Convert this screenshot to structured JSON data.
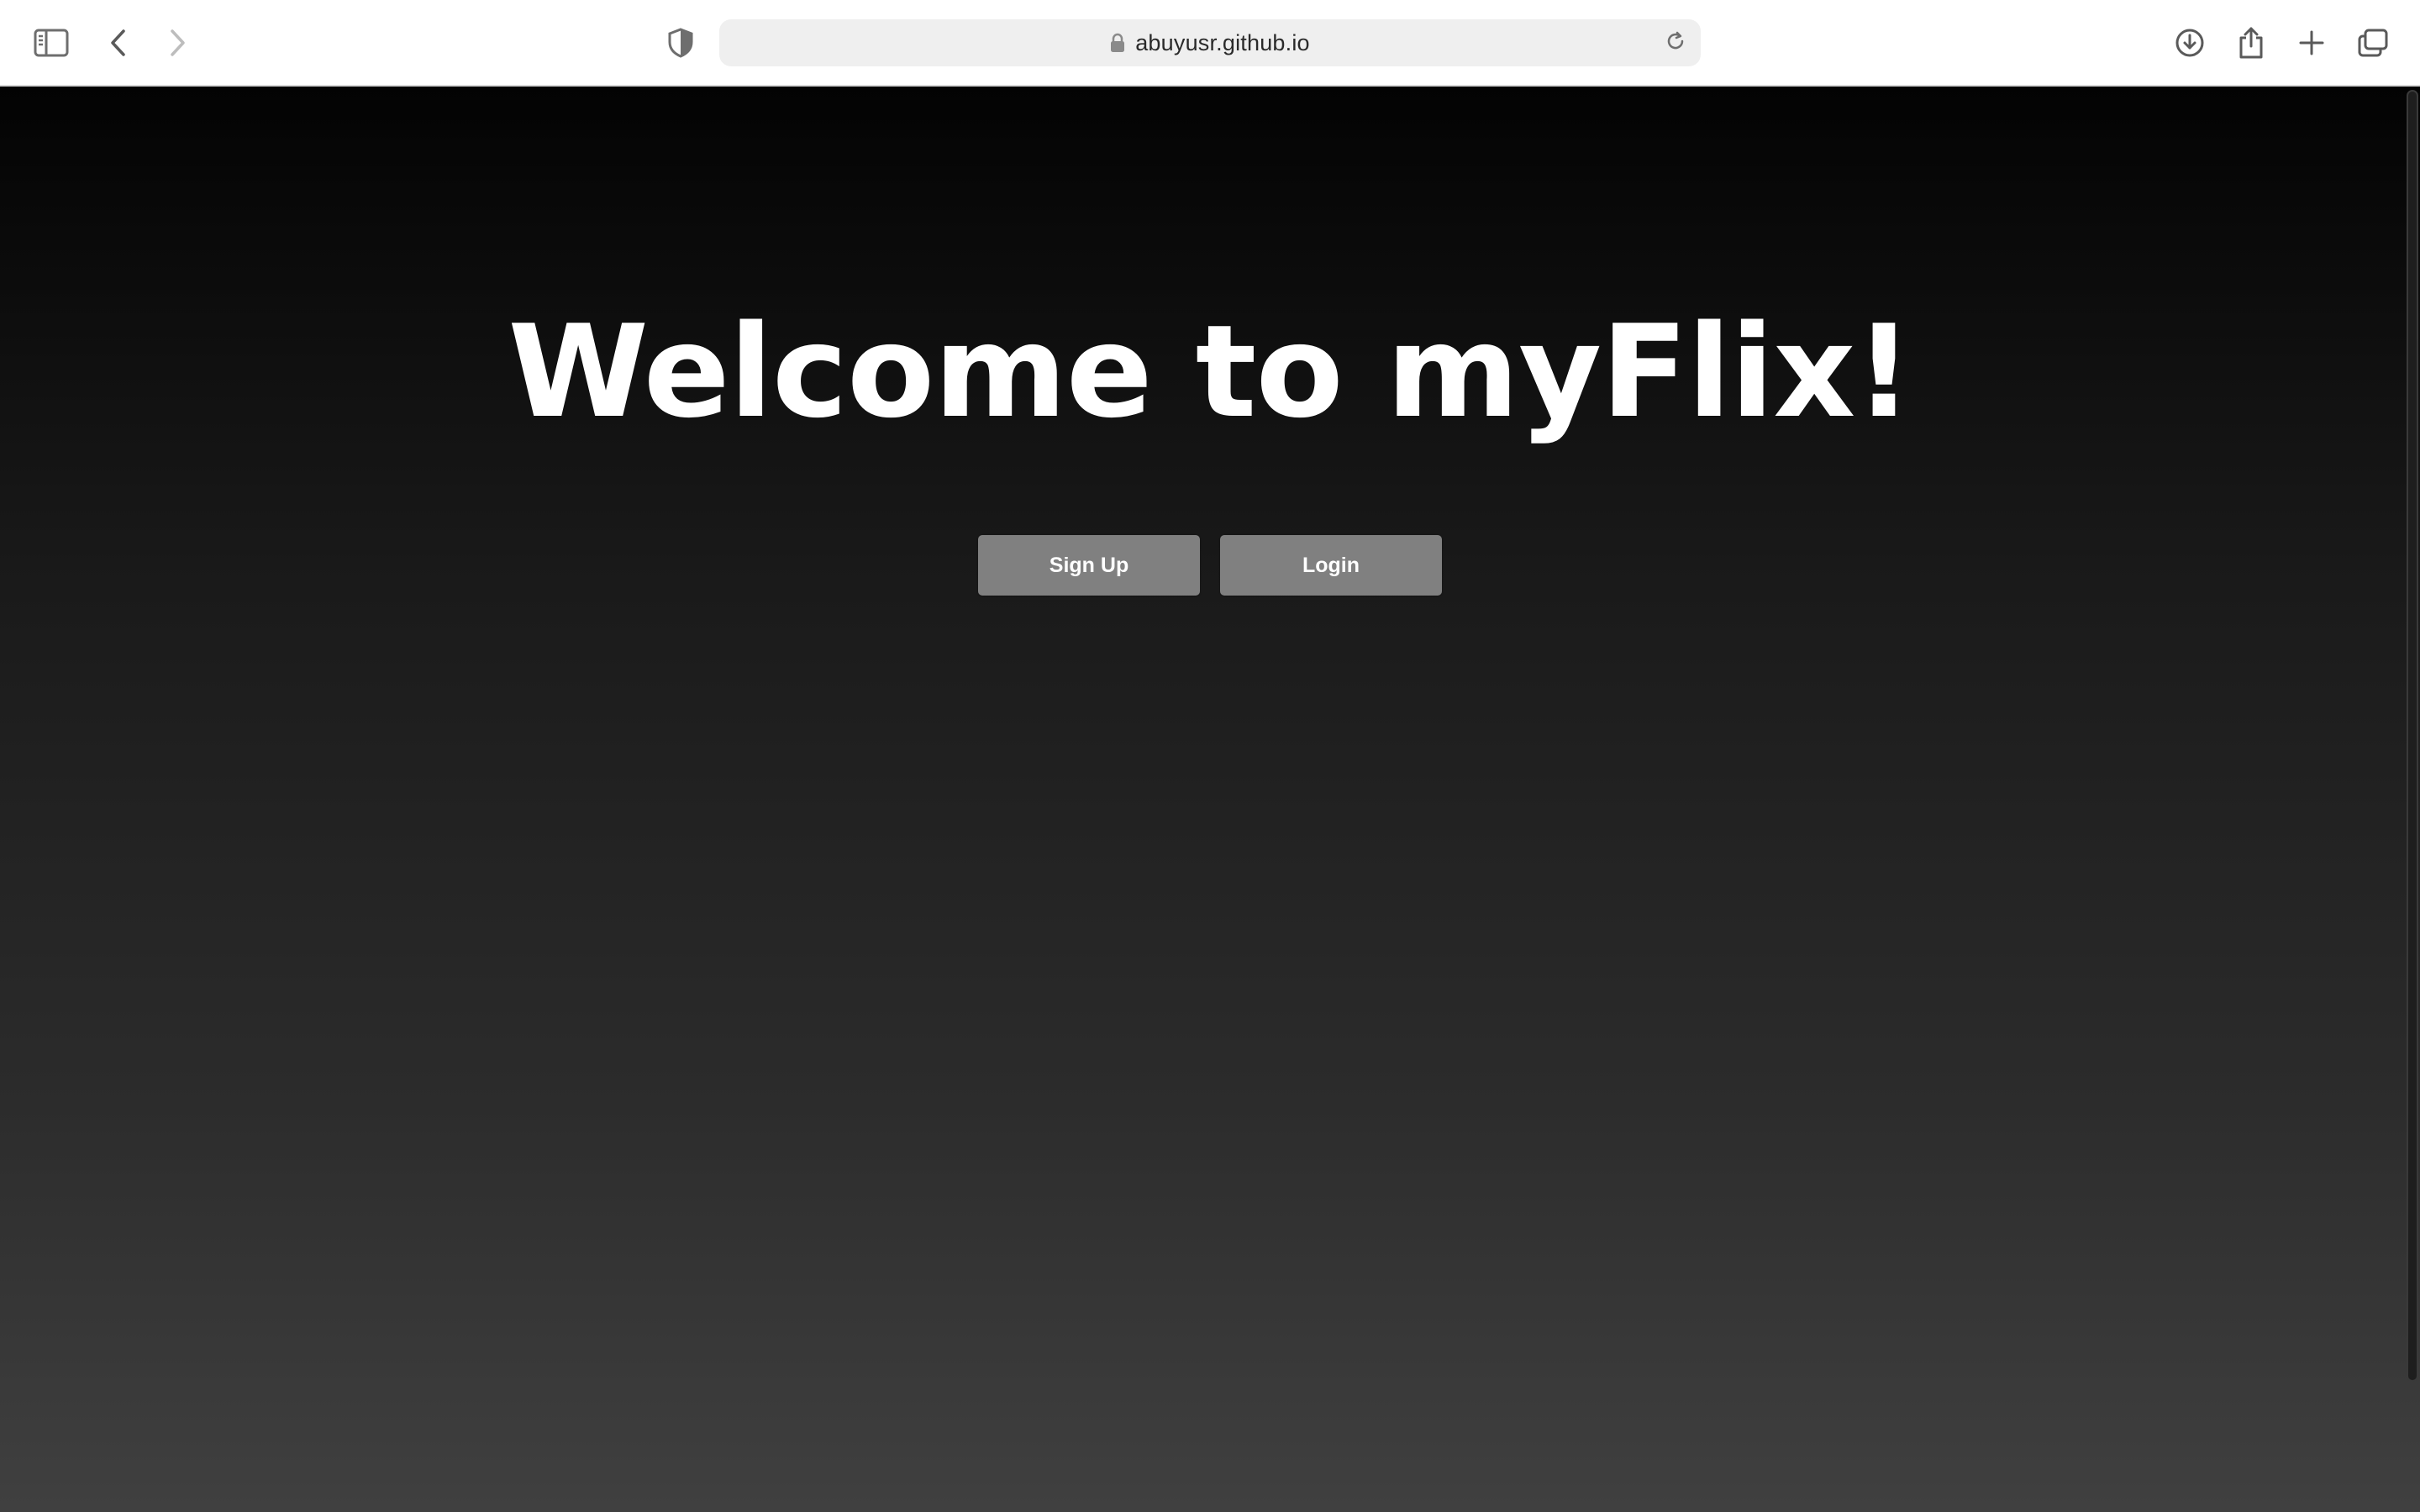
{
  "browser": {
    "address_bar": {
      "url": "abuyusr.github.io"
    }
  },
  "icons": {
    "sidebar": "sidebar-icon",
    "back": "chevron-left-icon",
    "forward": "chevron-right-icon",
    "privacy": "shield-icon",
    "lock": "lock-icon",
    "reload": "reload-icon",
    "downloads": "download-icon",
    "share": "share-icon",
    "new_tab": "plus-icon",
    "tabs": "tab-overview-icon"
  },
  "page": {
    "headline": "Welcome to myFlix!",
    "buttons": {
      "signup_label": "Sign Up",
      "login_label": "Login"
    }
  },
  "colors": {
    "button_bg": "#808080",
    "headline": "#ffffff",
    "page_gradient_top": "#030303",
    "page_gradient_bottom": "#404040"
  }
}
